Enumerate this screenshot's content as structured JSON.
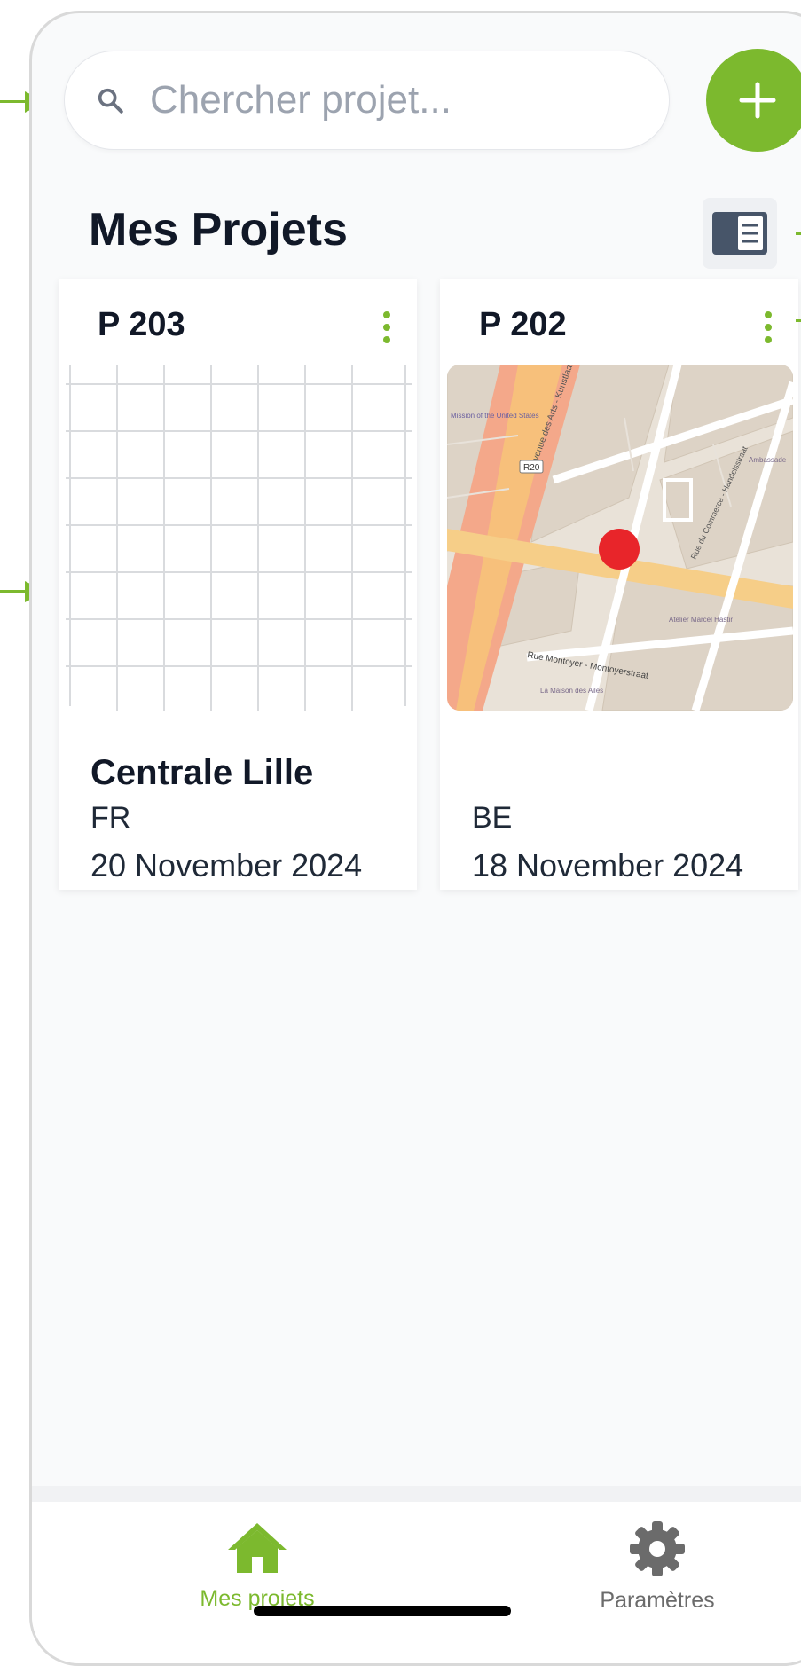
{
  "search": {
    "placeholder": "Chercher projet..."
  },
  "header": {
    "title": "Mes Projets"
  },
  "projects": [
    {
      "code": "P 203",
      "name": "Centrale Lille",
      "country": "FR",
      "date": "20 November 2024",
      "thumbnail": "grid"
    },
    {
      "code": "P 202",
      "name": "",
      "country": "BE",
      "date": "18 November 2024",
      "thumbnail": "map"
    }
  ],
  "map": {
    "streets": [
      "Rue Montoyer - Montoyerstraat",
      "Avenue des Arts - Kunstlaan",
      "Rue du Commerce - Handelsstraat",
      "R20"
    ],
    "places": [
      "Mission of the United States of America",
      "La Maison des Ailes",
      "Atelier Marcel Hastir",
      "Ambassade d'Estonie"
    ]
  },
  "tabbar": {
    "home_label": "Mes projets",
    "settings_label": "Paramètres"
  },
  "colors": {
    "accent": "#7cb92e",
    "marker": "#e8252a",
    "background": "#f9fafb"
  },
  "icons": {
    "search": "search-icon",
    "add": "plus-icon",
    "view": "list-view-icon",
    "menu": "kebab-menu-icon",
    "home": "home-icon",
    "settings": "gear-icon"
  }
}
